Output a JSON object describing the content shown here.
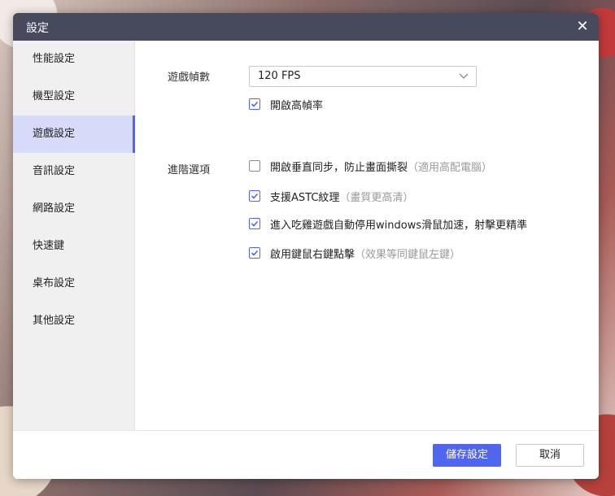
{
  "window": {
    "title": "設定"
  },
  "sidebar": {
    "items": [
      {
        "label": "性能設定"
      },
      {
        "label": "機型設定"
      },
      {
        "label": "遊戲設定",
        "active": true
      },
      {
        "label": "音訊設定"
      },
      {
        "label": "網路設定"
      },
      {
        "label": "快速鍵"
      },
      {
        "label": "桌布設定"
      },
      {
        "label": "其他設定"
      }
    ]
  },
  "main": {
    "frame_rate": {
      "label": "遊戲幀數",
      "selected": "120 FPS",
      "high_fps": {
        "label": "開啟高幀率",
        "checked": true
      }
    },
    "advanced": {
      "label": "進階選項",
      "options": [
        {
          "label": "開啟垂直同步，防止畫面撕裂",
          "note": "（適用高配電腦）",
          "checked": false
        },
        {
          "label": "支援ASTC紋理",
          "note": "（畫質更高清）",
          "checked": true
        },
        {
          "label": "進入吃雞遊戲自動停用windows滑鼠加速，射擊更精準",
          "note": "",
          "checked": true
        },
        {
          "label": "啟用鍵鼠右鍵點擊",
          "note": "（效果等同鍵鼠左鍵）",
          "checked": true
        }
      ]
    }
  },
  "footer": {
    "save_label": "儲存設定",
    "cancel_label": "取消"
  },
  "colors": {
    "accent": "#5066ee",
    "titlebar": "#464a5c",
    "sidebar_bg": "#f0f0f0",
    "active_bg": "#d7dbf9"
  }
}
